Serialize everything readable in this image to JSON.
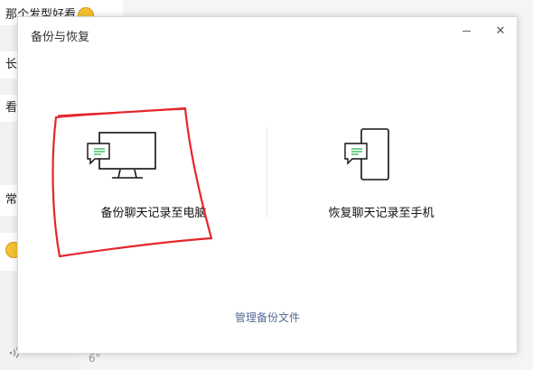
{
  "background": {
    "messages": [
      {
        "text": "那个发型好看"
      },
      {
        "text": "长"
      },
      {
        "text": "看"
      },
      {
        "text": "常"
      },
      {
        "text": ""
      }
    ],
    "duration": "6\""
  },
  "dialog": {
    "title": "备份与恢复",
    "minimize_icon": "minimize-icon",
    "close_icon": "close-icon",
    "close_glyph": "✕",
    "backup_option": {
      "label": "备份聊天记录至电脑",
      "icon": "monitor-chat-icon"
    },
    "restore_option": {
      "label": "恢复聊天记录至手机",
      "icon": "phone-chat-icon"
    },
    "manage_link": "管理备份文件"
  },
  "colors": {
    "link": "#576b95",
    "annotation": "#e3262b",
    "chat_lines": "#2bb24c"
  }
}
